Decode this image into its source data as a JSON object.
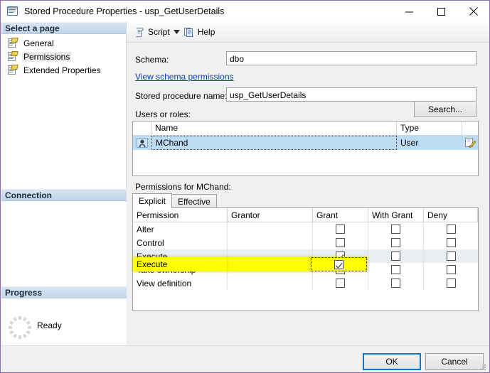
{
  "window": {
    "title": "Stored Procedure Properties - usp_GetUserDetails",
    "icon": "properties-window-icon",
    "minimize_label": "Minimize",
    "maximize_label": "Maximize",
    "close_label": "Close",
    "border_color": "#8e6fae"
  },
  "toolbar": {
    "script_label": "Script",
    "script_caret": "▼",
    "help_label": "Help"
  },
  "sidebar": {
    "select_page_header": "Select a page",
    "items": [
      {
        "label": "General",
        "selected": false
      },
      {
        "label": "Permissions",
        "selected": true
      },
      {
        "label": "Extended Properties",
        "selected": false
      }
    ],
    "connection_header": "Connection",
    "progress_header": "Progress",
    "progress_status": "Ready"
  },
  "form": {
    "schema_label": "Schema:",
    "schema_value": "dbo",
    "view_schema_permissions_link": "View schema permissions",
    "stored_procedure_name_label": "Stored procedure name:",
    "stored_procedure_name_value": "usp_GetUserDetails",
    "users_or_roles_label": "Users or roles:",
    "search_button": "Search...",
    "permissions_for_label": "Permissions for MChand:"
  },
  "users_grid": {
    "columns": [
      "",
      "Name",
      "Type",
      ""
    ],
    "rows": [
      {
        "icon": "user-icon",
        "name": "MChand",
        "type": "User",
        "action_icon": "edit-properties-icon",
        "selected": true
      }
    ]
  },
  "tabs": [
    {
      "label": "Explicit",
      "active": true
    },
    {
      "label": "Effective",
      "active": false
    }
  ],
  "permissions_grid": {
    "columns": [
      "Permission",
      "Grantor",
      "Grant",
      "With Grant",
      "Deny"
    ],
    "rows": [
      {
        "permission": "Alter",
        "grantor": "",
        "grant": false,
        "with_grant": false,
        "deny": false,
        "highlighted": false
      },
      {
        "permission": "Control",
        "grantor": "",
        "grant": false,
        "with_grant": false,
        "deny": false,
        "highlighted": false
      },
      {
        "permission": "Execute",
        "grantor": "",
        "grant": true,
        "with_grant": false,
        "deny": false,
        "highlighted": true
      },
      {
        "permission": "Take ownership",
        "grantor": "",
        "grant": false,
        "with_grant": false,
        "deny": false,
        "highlighted": false
      },
      {
        "permission": "View definition",
        "grantor": "",
        "grant": false,
        "with_grant": false,
        "deny": false,
        "highlighted": false
      }
    ],
    "highlight_color": "#ffff00"
  },
  "footer": {
    "ok_label": "OK",
    "cancel_label": "Cancel"
  }
}
